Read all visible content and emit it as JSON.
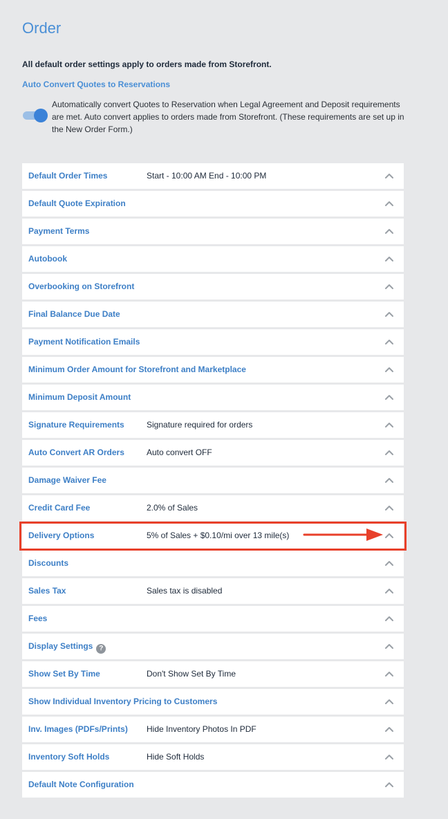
{
  "page": {
    "title": "Order",
    "intro": "All default order settings apply to orders made from Storefront."
  },
  "auto_convert": {
    "link_label": "Auto Convert Quotes to Reservations",
    "toggle_on": true,
    "description": "Automatically convert Quotes to Reservation when Legal Agreement and Deposit requirements are met. Auto convert applies to orders made from Storefront. (These requirements are set up in the New Order Form.)"
  },
  "settings": [
    {
      "label": "Default Order Times",
      "value": "Start - 10:00 AM End - 10:00 PM"
    },
    {
      "label": "Default Quote Expiration",
      "value": ""
    },
    {
      "label": "Payment Terms",
      "value": ""
    },
    {
      "label": "Autobook",
      "value": ""
    },
    {
      "label": "Overbooking on Storefront",
      "value": ""
    },
    {
      "label": "Final Balance Due Date",
      "value": ""
    },
    {
      "label": "Payment Notification Emails",
      "value": ""
    },
    {
      "label": "Minimum Order Amount for Storefront and Marketplace",
      "value": ""
    },
    {
      "label": "Minimum Deposit Amount",
      "value": ""
    },
    {
      "label": "Signature Requirements",
      "value": "Signature required for orders"
    },
    {
      "label": "Auto Convert AR Orders",
      "value": "Auto convert OFF"
    },
    {
      "label": "Damage Waiver Fee",
      "value": ""
    },
    {
      "label": "Credit Card Fee",
      "value": "2.0% of Sales"
    },
    {
      "label": "Delivery Options",
      "value": "5% of Sales + $0.10/mi over 13 mile(s)"
    },
    {
      "label": "Discounts",
      "value": ""
    },
    {
      "label": "Sales Tax",
      "value": "Sales tax is disabled"
    },
    {
      "label": "Fees",
      "value": ""
    },
    {
      "label": "Display Settings",
      "value": "",
      "help_icon": "?"
    },
    {
      "label": "Show Set By Time",
      "value": "Don't Show Set By Time"
    },
    {
      "label": "Show Individual Inventory Pricing to Customers",
      "value": ""
    },
    {
      "label": "Inv. Images (PDFs/Prints)",
      "value": "Hide Inventory Photos In PDF"
    },
    {
      "label": "Inventory Soft Holds",
      "value": "Hide Soft Holds"
    },
    {
      "label": "Default Note Configuration",
      "value": ""
    }
  ],
  "icons": {
    "row_toggle": "chevron-up-icon",
    "help": "question-circle-icon"
  },
  "annotation": {
    "highlighted_row": "Delivery Options",
    "color": "#e8402a"
  },
  "colors": {
    "accent": "#4a8fd6",
    "background": "#e7e8ea",
    "toggle_on": "#3b82d8"
  }
}
